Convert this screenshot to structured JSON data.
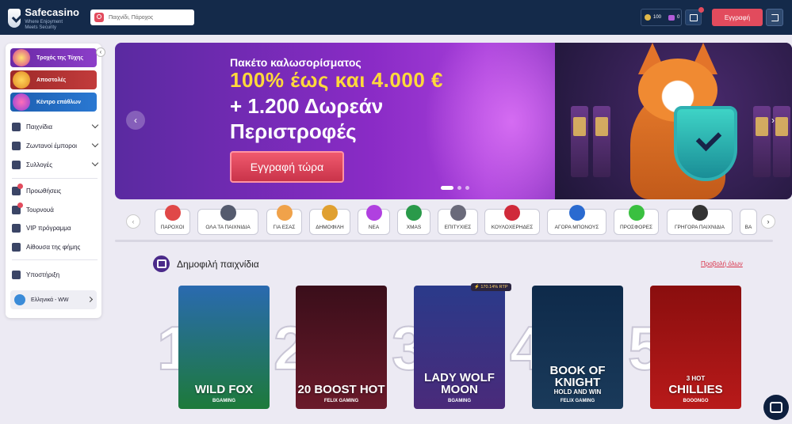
{
  "header": {
    "logo": {
      "name": "Safecasino",
      "tagline": "Where Enjoyment Meets Security"
    },
    "search": {
      "placeholder": "Παιχνίδι, Πάροχος"
    },
    "balance": {
      "coins": "100",
      "gems": "0"
    },
    "register_label": "Εγγραφή"
  },
  "sidebar": {
    "promos": [
      {
        "label": "Τροχός της Τύχης"
      },
      {
        "label": "Αποστολές"
      },
      {
        "label": "Κέντρο επάθλων"
      }
    ],
    "nav": [
      {
        "label": "Παιχνίδια"
      },
      {
        "label": "Ζωντανοί έμποροι"
      },
      {
        "label": "Συλλογές"
      },
      {
        "label": "Προωθήσεις"
      },
      {
        "label": "Τουρνουά"
      },
      {
        "label": "VIP πρόγραμμα"
      },
      {
        "label": "Αίθουσα της φήμης"
      },
      {
        "label": "Υποστήριξη"
      }
    ],
    "language": "Ελληνικά - WW"
  },
  "hero": {
    "line1": "Πακέτο καλωσορίσματος",
    "line2": "100% έως και 4.000 €",
    "line3": "+ 1.200 Δωρεάν Περιστροφές",
    "cta": "Εγγραφή τώρα",
    "prev_icon": "‹",
    "next_icon": "›"
  },
  "categories": [
    {
      "label": "ΠΑΡΟΧΟΙ",
      "color": "#e04848"
    },
    {
      "label": "ΟΛΑ ΤΑ ΠΑΙΧΝΙΔΙΑ",
      "color": "#555b6e"
    },
    {
      "label": "ΓΙΑ ΕΣΑΣ",
      "color": "#f0a24a"
    },
    {
      "label": "ΔΗΜΟΦΙΛΗ",
      "color": "#e0a030"
    },
    {
      "label": "ΝΕΑ",
      "color": "#b040e0",
      "badge": "new"
    },
    {
      "label": "XMAS",
      "color": "#2a9a4a"
    },
    {
      "label": "ΕΠΙΤΥΧΙΕΣ",
      "color": "#6a6a7a"
    },
    {
      "label": "ΚΟΥΛΟΧΕΡΗΔΕΣ",
      "color": "#d02a3a"
    },
    {
      "label": "ΑΓΟΡΑ ΜΠΟΝΟΥΣ",
      "color": "#2a6ad0"
    },
    {
      "label": "ΠΡΟΣΦΟΡΕΣ",
      "color": "#3ac040"
    },
    {
      "label": "ΓΡΗΓΟΡΑ ΠΑΙΧΝΙΔΙΑ",
      "color": "#333"
    },
    {
      "label": "ΒΑ",
      "color": "#888"
    }
  ],
  "section": {
    "title": "Δημοφιλή παιχνίδια",
    "view_all": "Προβολή όλων"
  },
  "games": [
    {
      "rank": "1",
      "name": "WILD FOX",
      "provider": "BGAMING",
      "bg": "#1d7a3a"
    },
    {
      "rank": "2",
      "name": "20 BOOST HOT",
      "provider": "FELIX GAMING",
      "bg": "#6a1a2a"
    },
    {
      "rank": "3",
      "name": "LADY WOLF MOON",
      "provider": "BGAMING",
      "bg": "#3a2a7a",
      "rtp": "⚡ 170.14% RTP"
    },
    {
      "rank": "4",
      "name": "BOOK OF KNIGHT",
      "sub": "HOLD AND WIN",
      "provider": "FELIX GAMING",
      "bg": "#1a3a5a"
    },
    {
      "rank": "5",
      "name": "CHILLIES",
      "sub": "3 HOT",
      "provider": "BOOONGO",
      "bg": "#b81a1a"
    }
  ]
}
